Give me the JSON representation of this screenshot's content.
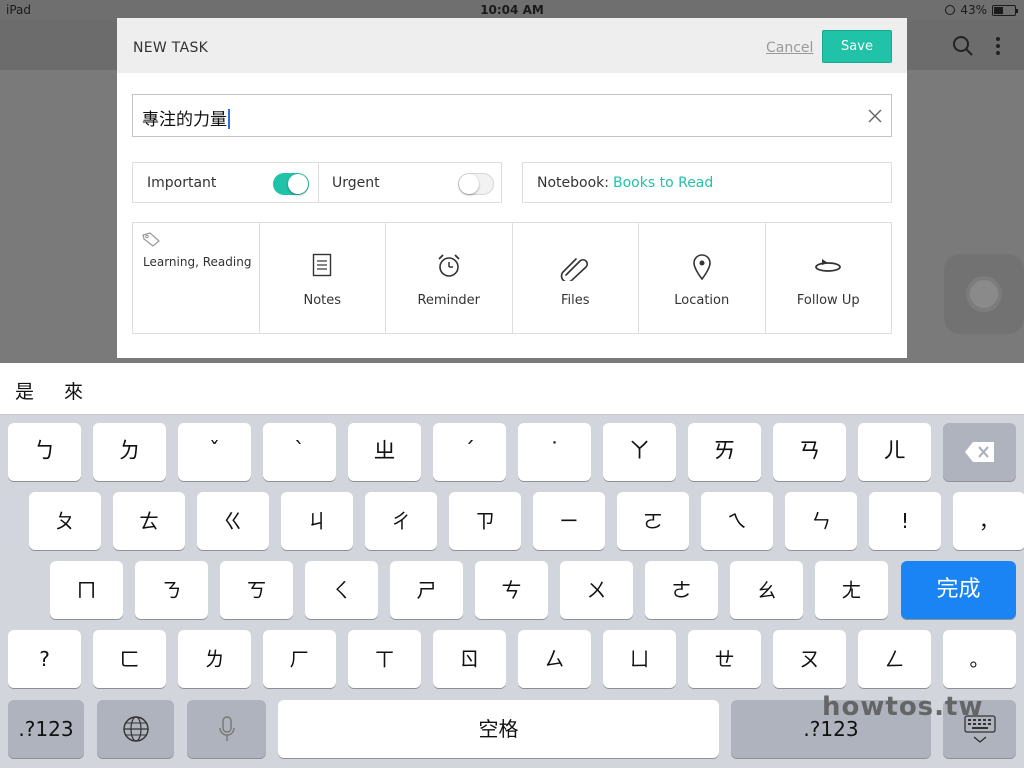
{
  "status_bar": {
    "device": "iPad",
    "time": "10:04 AM",
    "battery": "43%",
    "battery_level": 0.43
  },
  "app_bar": {
    "icons": [
      "search-icon",
      "more-vertical-icon"
    ]
  },
  "dialog": {
    "title": "NEW TASK",
    "cancel_label": "Cancel",
    "save_label": "Save",
    "task_title": "專注的力量",
    "important_label": "Important",
    "important_on": true,
    "urgent_label": "Urgent",
    "urgent_on": false,
    "notebook_label": "Notebook:",
    "notebook_value": "Books to Read",
    "tags": "Learning, Reading",
    "attachments": [
      {
        "label": "Notes",
        "icon": "notes-icon"
      },
      {
        "label": "Reminder",
        "icon": "alarm-clock-icon"
      },
      {
        "label": "Files",
        "icon": "paperclip-icon"
      },
      {
        "label": "Location",
        "icon": "location-pin-icon"
      },
      {
        "label": "Follow Up",
        "icon": "follow-up-icon"
      }
    ],
    "accent_color": "#20c2a8"
  },
  "suggestions": [
    "是",
    "來"
  ],
  "keyboard": {
    "row1": [
      "ㄅ",
      "ㄉ",
      "ˇ",
      "ˋ",
      "ㄓ",
      "ˊ",
      "˙",
      "ㄚ",
      "ㄞ",
      "ㄢ",
      "ㄦ"
    ],
    "row2": [
      "ㄆ",
      "ㄊ",
      "ㄍ",
      "ㄐ",
      "ㄔ",
      "ㄗ",
      "ㄧ",
      "ㄛ",
      "ㄟ",
      "ㄣ",
      "!",
      "，"
    ],
    "row3": [
      "ㄇ",
      "ㄋ",
      "ㄎ",
      "ㄑ",
      "ㄕ",
      "ㄘ",
      "ㄨ",
      "ㄜ",
      "ㄠ",
      "ㄤ"
    ],
    "row4": [
      "?",
      "ㄈ",
      "ㄌ",
      "ㄏ",
      "ㄒ",
      "ㄖ",
      "ㄙ",
      "ㄩ",
      "ㄝ",
      "ㄡ",
      "ㄥ",
      "。"
    ],
    "done_label": "完成",
    "numbers_label": ".?123",
    "space_label": "空格",
    "done_color": "#1a84f4"
  },
  "watermark": "howtos.tw"
}
